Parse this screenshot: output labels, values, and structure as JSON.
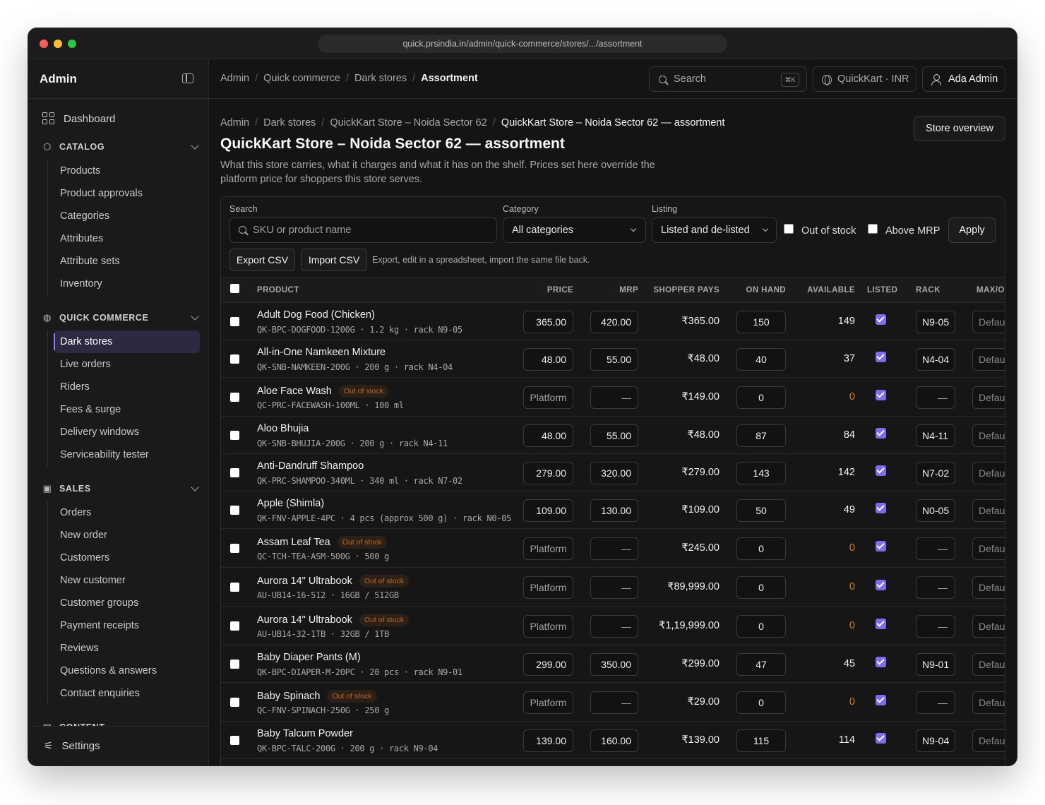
{
  "browser": {
    "url": "quick.prsindia.in/admin/quick-commerce/stores/.../assortment"
  },
  "sidebar": {
    "title": "Admin",
    "dashboard": "Dashboard",
    "sections": [
      {
        "label": "CATALOG",
        "icon": "cube-icon",
        "items": [
          "Products",
          "Product approvals",
          "Categories",
          "Attributes",
          "Attribute sets",
          "Inventory"
        ]
      },
      {
        "label": "QUICK COMMERCE",
        "icon": "globe-icon",
        "items": [
          "Dark stores",
          "Live orders",
          "Riders",
          "Fees & surge",
          "Delivery windows",
          "Serviceability tester"
        ]
      },
      {
        "label": "SALES",
        "icon": "bag-icon",
        "items": [
          "Orders",
          "New order",
          "Customers",
          "New customer",
          "Customer groups",
          "Payment receipts",
          "Reviews",
          "Questions & answers",
          "Contact enquiries"
        ]
      },
      {
        "label": "CONTENT",
        "icon": "doc-icon",
        "items": []
      }
    ],
    "active_item": "Dark stores",
    "settings": "Settings"
  },
  "topbar": {
    "breadcrumb": [
      "Admin",
      "Quick commerce",
      "Dark stores",
      "Assortment"
    ],
    "search_label": "Search",
    "search_shortcut": "⌘K",
    "store_label": "QuickKart · INR",
    "user_label": "Ada Admin"
  },
  "page": {
    "breadcrumb": [
      "Admin",
      "Dark stores",
      "QuickKart Store – Noida Sector 62",
      "QuickKart Store – Noida Sector 62 — assortment"
    ],
    "title": "QuickKart Store – Noida Sector 62 — assortment",
    "description": "What this store carries, what it charges and what it has on the shelf. Prices set here override the platform price for shoppers this store serves.",
    "overview_button": "Store overview"
  },
  "filters": {
    "search_label": "Search",
    "search_placeholder": "SKU or product name",
    "category_label": "Category",
    "category_value": "All categories",
    "listing_label": "Listing",
    "listing_value": "Listed and de-listed",
    "out_of_stock_label": "Out of stock",
    "above_mrp_label": "Above MRP",
    "apply_label": "Apply",
    "export_label": "Export CSV",
    "import_label": "Import CSV",
    "csv_hint": "Export, edit in a spreadsheet, import the same file back."
  },
  "table": {
    "columns": [
      "PRODUCT",
      "PRICE",
      "MRP",
      "SHOPPER PAYS",
      "ON HAND",
      "AVAILABLE",
      "LISTED",
      "RACK",
      "MAX/O"
    ],
    "rows": [
      {
        "name": "Adult Dog Food (Chicken)",
        "badge": "",
        "sku": "QK-BPC-DOGFOOD-1200G · 1.2 kg · rack N9-05",
        "price": "365.00",
        "mrp": "420.00",
        "pays": "₹365.00",
        "on_hand": "150",
        "available": "149",
        "rack": "N9-05",
        "max": "Default"
      },
      {
        "name": "All-in-One Namkeen Mixture",
        "badge": "",
        "sku": "QK-SNB-NAMKEEN-200G · 200 g · rack N4-04",
        "price": "48.00",
        "mrp": "55.00",
        "pays": "₹48.00",
        "on_hand": "40",
        "available": "37",
        "rack": "N4-04",
        "max": "Default"
      },
      {
        "name": "Aloe Face Wash",
        "badge": "Out of stock",
        "sku": "QC-PRC-FACEWASH-100ML · 100 ml",
        "price": "Platform",
        "mrp": "—",
        "pays": "₹149.00",
        "on_hand": "0",
        "available": "0",
        "rack": "—",
        "max": "Default"
      },
      {
        "name": "Aloo Bhujia",
        "badge": "",
        "sku": "QK-SNB-BHUJIA-200G · 200 g · rack N4-11",
        "price": "48.00",
        "mrp": "55.00",
        "pays": "₹48.00",
        "on_hand": "87",
        "available": "84",
        "rack": "N4-11",
        "max": "Default"
      },
      {
        "name": "Anti-Dandruff Shampoo",
        "badge": "",
        "sku": "QK-PRC-SHAMPOO-340ML · 340 ml · rack N7-02",
        "price": "279.00",
        "mrp": "320.00",
        "pays": "₹279.00",
        "on_hand": "143",
        "available": "142",
        "rack": "N7-02",
        "max": "Default"
      },
      {
        "name": "Apple (Shimla)",
        "badge": "",
        "sku": "QK-FNV-APPLE-4PC · 4 pcs (approx 500 g) · rack N0-05",
        "price": "109.00",
        "mrp": "130.00",
        "pays": "₹109.00",
        "on_hand": "50",
        "available": "49",
        "rack": "N0-05",
        "max": "Default"
      },
      {
        "name": "Assam Leaf Tea",
        "badge": "Out of stock",
        "sku": "QC-TCH-TEA-ASM-500G · 500 g",
        "price": "Platform",
        "mrp": "—",
        "pays": "₹245.00",
        "on_hand": "0",
        "available": "0",
        "rack": "—",
        "max": "Default"
      },
      {
        "name": "Aurora 14\" Ultrabook",
        "badge": "Out of stock",
        "sku": "AU-UB14-16-512 · 16GB / 512GB",
        "price": "Platform",
        "mrp": "—",
        "pays": "₹89,999.00",
        "on_hand": "0",
        "available": "0",
        "rack": "—",
        "max": "Default"
      },
      {
        "name": "Aurora 14\" Ultrabook",
        "badge": "Out of stock",
        "sku": "AU-UB14-32-1TB · 32GB / 1TB",
        "price": "Platform",
        "mrp": "—",
        "pays": "₹1,19,999.00",
        "on_hand": "0",
        "available": "0",
        "rack": "—",
        "max": "Default"
      },
      {
        "name": "Baby Diaper Pants (M)",
        "badge": "",
        "sku": "QK-BPC-DIAPER-M-20PC · 20 pcs · rack N9-01",
        "price": "299.00",
        "mrp": "350.00",
        "pays": "₹299.00",
        "on_hand": "47",
        "available": "45",
        "rack": "N9-01",
        "max": "Default"
      },
      {
        "name": "Baby Spinach",
        "badge": "Out of stock",
        "sku": "QC-FNV-SPINACH-250G · 250 g",
        "price": "Platform",
        "mrp": "—",
        "pays": "₹29.00",
        "on_hand": "0",
        "available": "0",
        "rack": "—",
        "max": "Default"
      },
      {
        "name": "Baby Talcum Powder",
        "badge": "",
        "sku": "QK-BPC-TALC-200G · 200 g · rack N9-04",
        "price": "139.00",
        "mrp": "160.00",
        "pays": "₹139.00",
        "on_hand": "115",
        "available": "114",
        "rack": "N9-04",
        "max": "Default"
      }
    ]
  },
  "colors": {
    "accent": "#7c6cf0",
    "zero_stock": "#d7801f",
    "badge_text": "#c2661e"
  }
}
